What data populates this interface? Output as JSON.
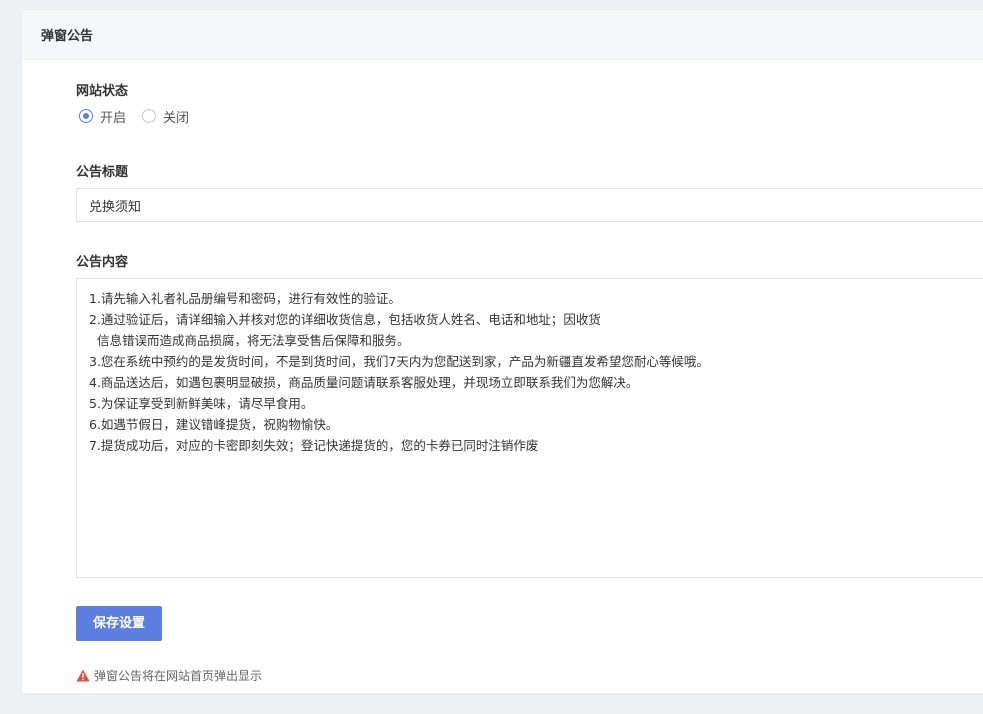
{
  "panel": {
    "title": "弹窗公告"
  },
  "site_status": {
    "label": "网站状态",
    "options": [
      {
        "label": "开启",
        "checked": true
      },
      {
        "label": "关闭",
        "checked": false
      }
    ]
  },
  "notice_title": {
    "label": "公告标题",
    "value": "兑换须知"
  },
  "notice_content": {
    "label": "公告内容",
    "value": "1.请先输入礼者礼品册编号和密码，进行有效性的验证。\n2.通过验证后，请详细输入并核对您的详细收货信息，包括收货人姓名、电话和地址；因收货\n  信息错误而造成商品损腐，将无法享受售后保障和服务。\n3.您在系统中预约的是发货时间，不是到货时间，我们7天内为您配送到家，产品为新疆直发希望您耐心等候哦。\n4.商品送达后，如遇包裹明显破损，商品质量问题请联系客服处理，并现场立即联系我们为您解决。\n5.为保证享受到新鲜美味，请尽早食用。\n6.如遇节假日，建议错峰提货，祝购物愉快。\n7.提货成功后，对应的卡密即刻失效；登记快递提货的，您的卡券已同时注销作废"
  },
  "save_button": {
    "label": "保存设置",
    "color": "#5b7edf"
  },
  "hint": {
    "icon": "warning-icon",
    "text": "弹窗公告将在网站首页弹出显示",
    "icon_color": "#e0504a"
  }
}
